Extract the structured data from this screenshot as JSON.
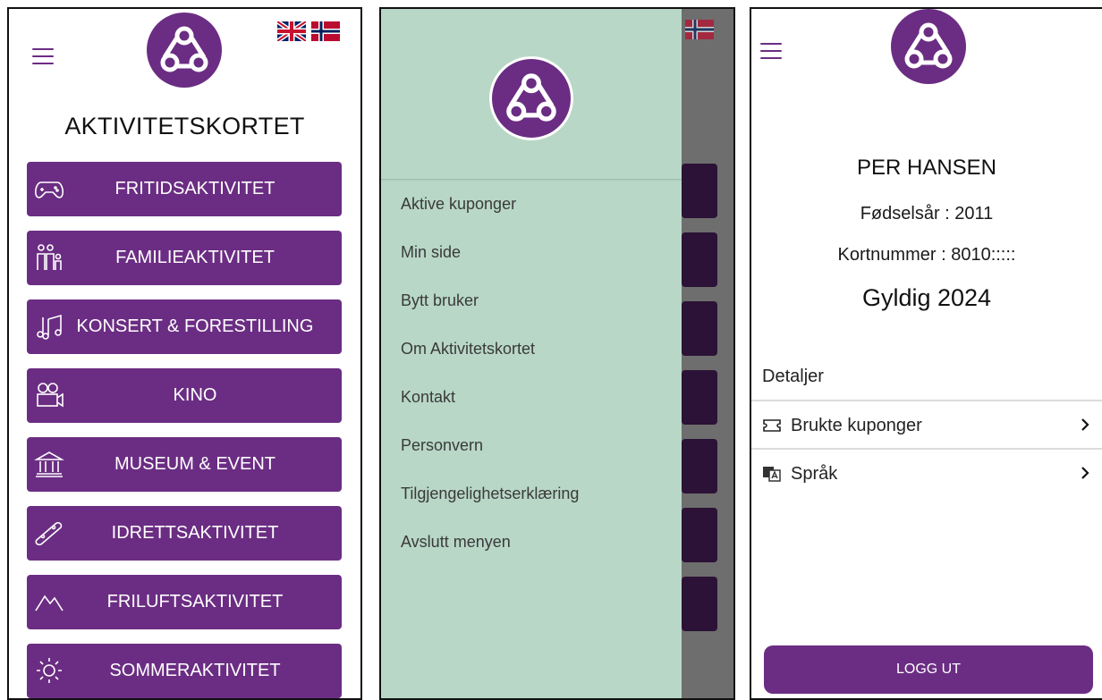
{
  "screen1": {
    "title": "AKTIVITETSKORTET",
    "categories": [
      {
        "label": "FRITIDSAKTIVITET",
        "icon": "gamepad-icon"
      },
      {
        "label": "FAMILIEAKTIVITET",
        "icon": "family-icon"
      },
      {
        "label": "KONSERT & FORESTILLING",
        "icon": "music-note-icon"
      },
      {
        "label": "KINO",
        "icon": "movie-camera-icon"
      },
      {
        "label": "MUSEUM & EVENT",
        "icon": "museum-icon"
      },
      {
        "label": "IDRETTSAKTIVITET",
        "icon": "skateboard-icon"
      },
      {
        "label": "FRILUFTSAKTIVITET",
        "icon": "mountain-icon"
      },
      {
        "label": "SOMMERAKTIVITET",
        "icon": "sun-icon"
      }
    ]
  },
  "screen2": {
    "menu_items": [
      {
        "label": "Aktive kuponger"
      },
      {
        "label": "Min side"
      },
      {
        "label": "Bytt bruker"
      },
      {
        "label": "Om Aktivitetskortet"
      },
      {
        "label": "Kontakt"
      },
      {
        "label": "Personvern"
      },
      {
        "label": "Tilgjengelighetserklæring"
      },
      {
        "label": "Avslutt menyen"
      }
    ]
  },
  "screen3": {
    "name": "PER HANSEN",
    "birth_year_line": "Fødselsår : 2011",
    "card_number_line": "Kortnummer : 8010:::::",
    "valid_line": "Gyldig 2024",
    "details_title": "Detaljer",
    "rows": [
      {
        "label": "Brukte kuponger",
        "icon": "ticket-icon"
      },
      {
        "label": "Språk",
        "icon": "translate-icon"
      }
    ],
    "logout_label": "LOGG UT"
  },
  "colors": {
    "brand_purple": "#6b2d83",
    "drawer_green": "#b8d7c7",
    "overlay_gray": "#6e6e6e"
  }
}
